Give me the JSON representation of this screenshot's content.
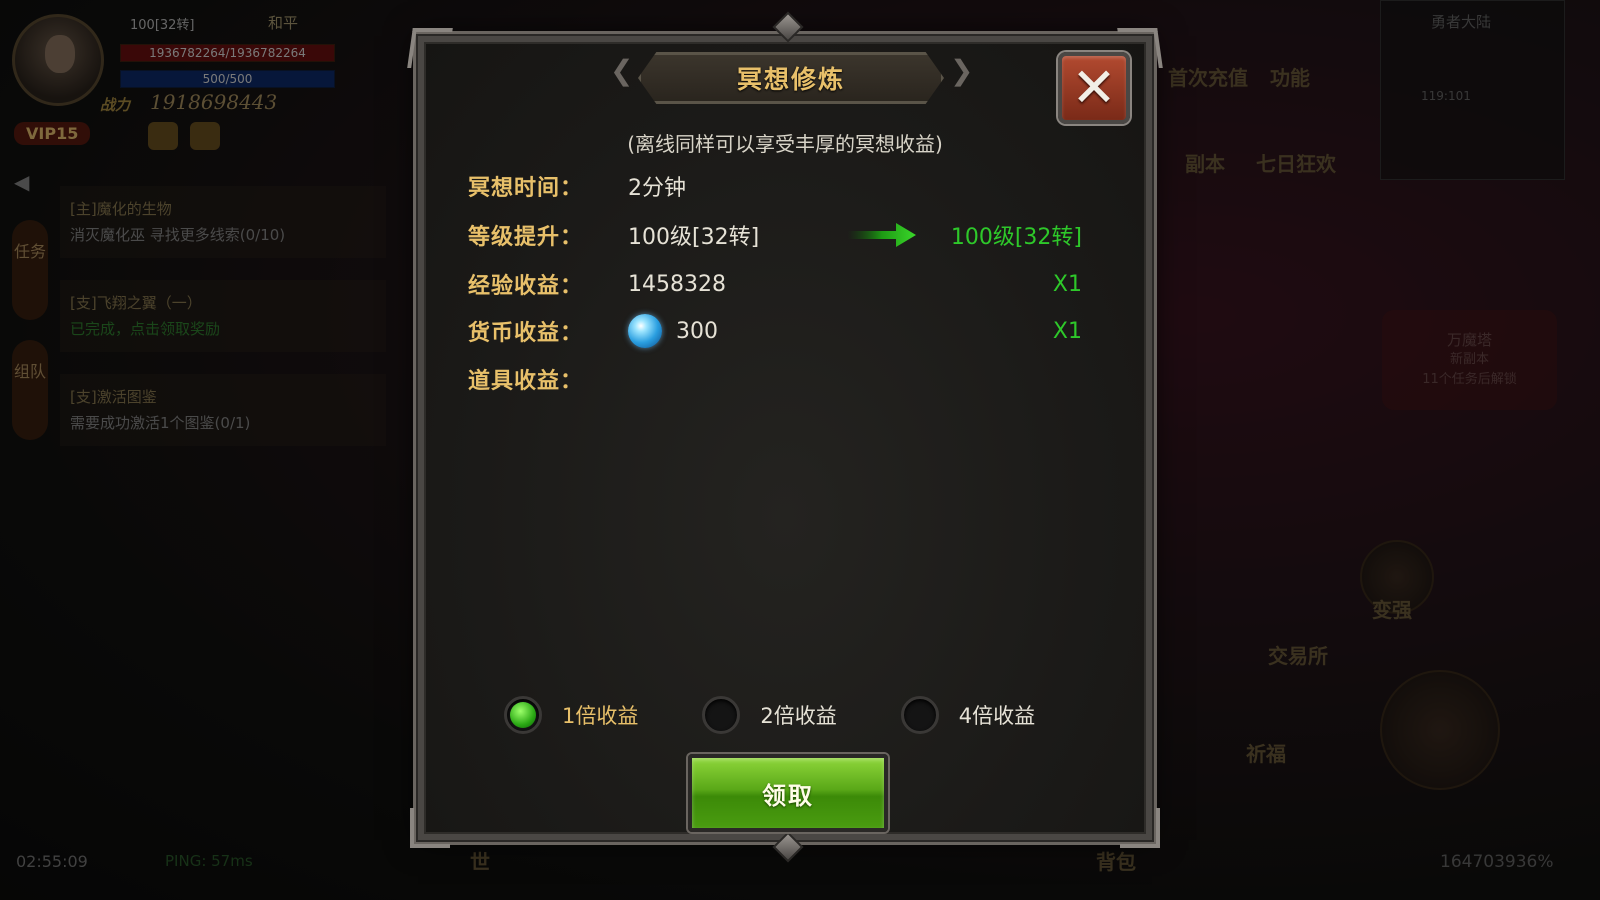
{
  "hud": {
    "level": "100[32转]",
    "mode": "和平",
    "hp": "1936782264/1936782264",
    "mp": "500/500",
    "power_label": "战力",
    "power": "1918698443",
    "vip": "VIP15",
    "side_tabs": [
      "任务",
      "组队"
    ],
    "quests": [
      {
        "title": "[主]魔化的生物",
        "desc": "消灭魔化巫 寻找更多线索(0/10)"
      },
      {
        "title": "[支]飞翔之翼（一）",
        "desc": "已完成，点击领取奖励"
      },
      {
        "title": "[支]激活图鉴",
        "desc": "需要成功激活1个图鉴(0/1)"
      }
    ],
    "clock": "02:55:09",
    "ping": "PING: 57ms",
    "map_name": "勇者大陆",
    "map_coords": "119:101",
    "right_buttons": [
      "首次充值",
      "功能",
      "副本",
      "七日狂欢",
      "变强",
      "交易所",
      "祈福"
    ],
    "tower_name": "万魔塔",
    "tower_sub": "新副本",
    "tower_lock": "11个任务后解锁",
    "bottom_left": "世",
    "bottom_right": "背包",
    "percent": "164703936%"
  },
  "dialog": {
    "title": "冥想修炼",
    "subtitle": "(离线同样可以享受丰厚的冥想收益)",
    "rows": {
      "time": {
        "label": "冥想时间：",
        "value": "2分钟"
      },
      "level": {
        "label": "等级提升：",
        "from": "100级[32转]",
        "to": "100级[32转]"
      },
      "exp": {
        "label": "经验收益：",
        "value": "1458328",
        "mult": "X1"
      },
      "currency": {
        "label": "货币收益：",
        "value": "300",
        "mult": "X1"
      },
      "items": {
        "label": "道具收益："
      }
    },
    "options": [
      {
        "label": "1倍收益",
        "selected": true
      },
      {
        "label": "2倍收益",
        "selected": false
      },
      {
        "label": "4倍收益",
        "selected": false
      }
    ],
    "claim_label": "领取"
  },
  "colors": {
    "gold": "#e8c06a",
    "green": "#2ec82a",
    "close_red": "#b24a30",
    "claim_green": "#5aa818"
  }
}
